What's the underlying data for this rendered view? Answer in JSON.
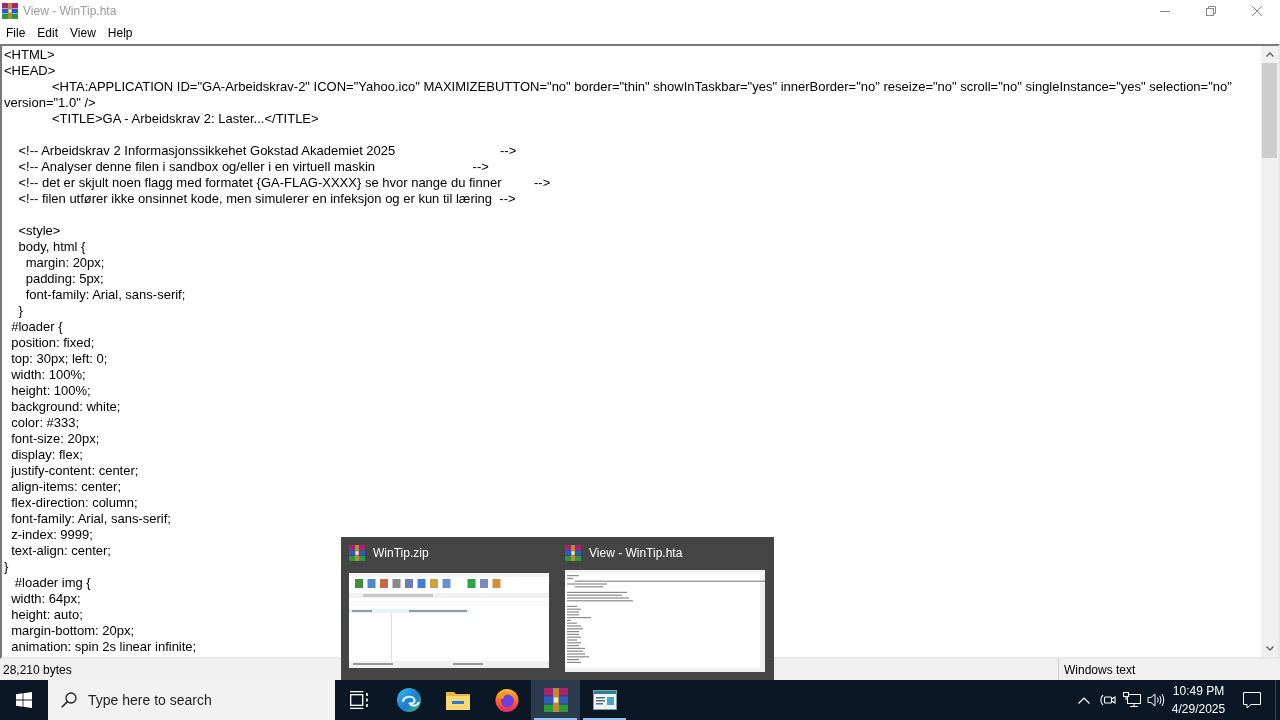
{
  "window": {
    "title": "View - WinTip.hta",
    "active": false
  },
  "menu": [
    {
      "label": "File"
    },
    {
      "label": "Edit"
    },
    {
      "label": "View"
    },
    {
      "label": "Help"
    }
  ],
  "document": {
    "lines": [
      {
        "kind": "code",
        "text": "<HTML>"
      },
      {
        "kind": "code",
        "text": "<HEAD>"
      },
      {
        "kind": "code",
        "text": "\t<HTA:APPLICATION ID=\"GA-Arbeidskrav-2\" ICON=\"Yahoo.ico\" MAXIMIZEBUTTON=\"no\" border=\"thin\" showInTaskbar=\"yes\" innerBorder=\"no\" reseize=\"no\" scroll=\"no\" singleInstance=\"yes\" selection=\"no\""
      },
      {
        "kind": "code",
        "text": "version=\"1.0\" />"
      },
      {
        "kind": "code",
        "text": "\t<TITLE>GA - Arbeidskrav 2: Laster...</TITLE>"
      },
      {
        "kind": "blank"
      },
      {
        "kind": "code",
        "text": "    <!-- Arbeidskrav 2 Informasjonssikkehet Gokstad Akademiet 2025                             -->"
      },
      {
        "kind": "code",
        "text": "    <!-- Analyser denne filen i sandbox og/eller i en virtuell maskin                           -->"
      },
      {
        "kind": "code",
        "text": "    <!-- det er skjult noen flagg med formatet {GA-FLAG-XXXX} se hvor nange du finner         -->"
      },
      {
        "kind": "code",
        "text": "    <!-- filen utfører ikke onsinnet kode, men simulerer en infeksjon og er kun til læring  -->"
      },
      {
        "kind": "blank"
      },
      {
        "kind": "code",
        "text": "    <style>"
      },
      {
        "kind": "code",
        "text": "    body, html {"
      },
      {
        "kind": "code",
        "text": "      margin: 20px;"
      },
      {
        "kind": "code",
        "text": "      padding: 5px;"
      },
      {
        "kind": "code",
        "text": "      font-family: Arial, sans-serif;"
      },
      {
        "kind": "code",
        "text": "    }"
      },
      {
        "kind": "code",
        "text": "  #loader {"
      },
      {
        "kind": "code",
        "text": "  position: fixed;"
      },
      {
        "kind": "code",
        "text": "  top: 30px; left: 0;"
      },
      {
        "kind": "code",
        "text": "  width: 100%;"
      },
      {
        "kind": "code",
        "text": "  height: 100%;"
      },
      {
        "kind": "code",
        "text": "  background: white;"
      },
      {
        "kind": "code",
        "text": "  color: #333;"
      },
      {
        "kind": "code",
        "text": "  font-size: 20px;"
      },
      {
        "kind": "code",
        "text": "  display: flex;"
      },
      {
        "kind": "code",
        "text": "  justify-content: center;"
      },
      {
        "kind": "code",
        "text": "  align-items: center;"
      },
      {
        "kind": "code",
        "text": "  flex-direction: column;"
      },
      {
        "kind": "code",
        "text": "  font-family: Arial, sans-serif;"
      },
      {
        "kind": "code",
        "text": "  z-index: 9999;"
      },
      {
        "kind": "code",
        "text": "  text-align: center;"
      },
      {
        "kind": "code",
        "text": "}"
      },
      {
        "kind": "code",
        "text": "   #loader img {"
      },
      {
        "kind": "code",
        "text": "  width: 64px;"
      },
      {
        "kind": "code",
        "text": "  height: auto;"
      },
      {
        "kind": "code",
        "text": "  margin-bottom: 20px;"
      },
      {
        "kind": "code",
        "text": "  animation: spin 2s linear infinite;"
      }
    ]
  },
  "status_bar": {
    "size": "28,210 bytes",
    "encoding": "Windows text"
  },
  "taskbar": {
    "search": {
      "placeholder": "Type here to search"
    },
    "apps": [
      {
        "kind": "browser",
        "running": false,
        "selected": false
      },
      {
        "kind": "folder",
        "running": false,
        "selected": false
      },
      {
        "kind": "fox",
        "running": false,
        "selected": false
      },
      {
        "kind": "archiver",
        "running": true,
        "selected": true
      },
      {
        "kind": "viewer",
        "running": true,
        "selected": false
      }
    ],
    "clock": {
      "time": "10:49 PM",
      "date": "4/29/2025"
    }
  },
  "taskbar_preview": {
    "windows": [
      {
        "kind": "archive",
        "title": "WinTip.zip"
      },
      {
        "kind": "text",
        "title": "View - WinTip.hta"
      }
    ]
  }
}
